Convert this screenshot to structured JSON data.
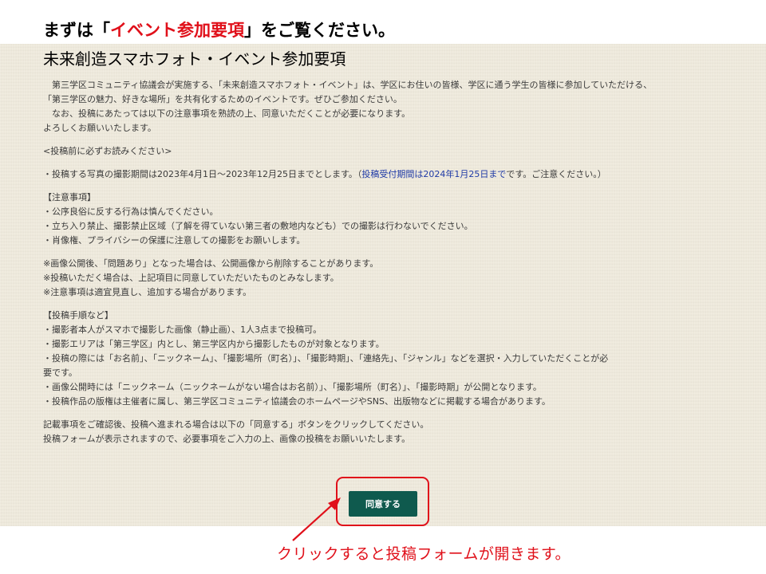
{
  "header": {
    "instruction_pre": "まずは「",
    "instruction_highlight": "イベント参加要項",
    "instruction_post": "」をご覧ください。",
    "subtitle": "未来創造スマホフォト・イベント参加要項"
  },
  "content": {
    "intro": [
      "　第三学区コミュニティ協議会が実施する、「未来創造スマホフォト・イベント」は、学区にお住いの皆様、学区に通う学生の皆様に参加していただける、",
      "「第三学区の魅力、好きな場所」を共有化するためのイベントです。ぜひご参加ください。",
      "　なお、投稿にあたっては以下の注意事項を熟読の上、同意いただくことが必要になります。",
      "よろしくお願いいたします。"
    ],
    "read_before_heading": "<投稿前に必ずお読みください>",
    "period_line_pre": "・投稿する写真の撮影期間は2023年4月1日～2023年12月25日までとします。（",
    "period_line_blue": "投稿受付期間は2024年1月25日まで",
    "period_line_post": "です。ご注意ください。）",
    "notes_heading": "【注意事項】",
    "notes": [
      "・公序良俗に反する行為は慎んでください。",
      "・立ち入り禁止、撮影禁止区域（了解を得ていない第三者の敷地内なども）での撮影は行わないでください。",
      "・肖像権、プライバシーの保護に注意しての撮影をお願いします。"
    ],
    "remarks": [
      "※画像公開後、「問題あり」となった場合は、公開画像から削除することがあります。",
      "※投稿いただく場合は、上記項目に同意していただいたものとみなします。",
      "※注意事項は適宜見直し、追加する場合があります。"
    ],
    "procedure_heading": "【投稿手順など】",
    "procedure": [
      "・撮影者本人がスマホで撮影した画像（静止画）、1人3点まで投稿可。",
      "・撮影エリアは「第三学区」内とし、第三学区内から撮影したものが対象となります。",
      "・投稿の際には「お名前」、「ニックネーム」、「撮影場所（町名）」、「撮影時期」、「連絡先」、「ジャンル」などを選択・入力していただくことが必",
      "要です。",
      "・画像公開時には「ニックネーム（ニックネームがない場合はお名前）」、「撮影場所（町名）」、「撮影時期」が公開となります。",
      "・投稿作品の版権は主催者に属し、第三学区コミュニティ協議会のホームページやSNS、出版物などに掲載する場合があります。"
    ],
    "closing": [
      "記載事項をご確認後、投稿へ進まれる場合は以下の「同意する」ボタンをクリックしてください。",
      "投稿フォームが表示されますので、必要事項をご入力の上、画像の投稿をお願いいたします。"
    ]
  },
  "agree_button": {
    "label": "同意する"
  },
  "annotation": {
    "text": "クリックすると投稿フォームが開きます。"
  },
  "colors": {
    "accent_red": "#e0101a",
    "button_green": "#0f5a4e",
    "paper_bg": "#efeadc",
    "link_blue": "#1f3aa6"
  }
}
